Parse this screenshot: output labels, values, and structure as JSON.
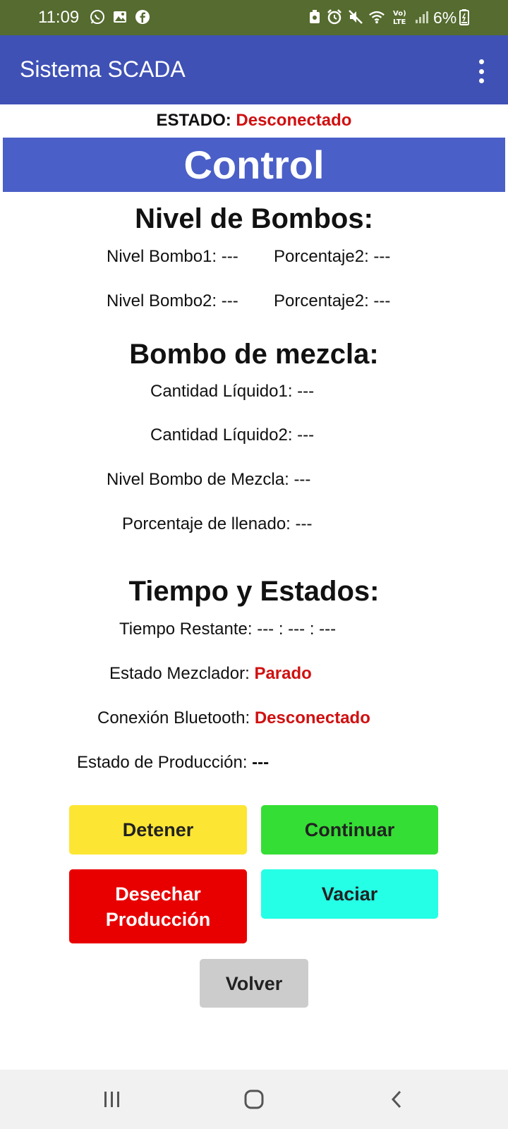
{
  "status_bar": {
    "time": "11:09",
    "battery": "6%",
    "left_icons": [
      "whatsapp-icon",
      "gallery-icon",
      "facebook-icon"
    ],
    "right_icons": [
      "battery-saver-icon",
      "alarm-icon",
      "mute-icon",
      "wifi-icon",
      "volte-icon",
      "signal-icon",
      "battery-icon"
    ]
  },
  "app_bar": {
    "title": "Sistema SCADA",
    "menu_icon": "overflow-menu-icon",
    "background": "#3f51b5"
  },
  "estado": {
    "label": "ESTADO:",
    "value": "Desconectado",
    "value_color": "#d01010"
  },
  "banner": {
    "title": "Control",
    "background": "#4a5fc7"
  },
  "nivel_bombos": {
    "title": "Nivel de Bombos:",
    "rows": [
      {
        "left": "Nivel Bombo1: ---",
        "right": "Porcentaje2: ---"
      },
      {
        "left": "Nivel Bombo2: ---",
        "right": "Porcentaje2: ---"
      }
    ]
  },
  "bombo_mezcla": {
    "title": "Bombo de mezcla:",
    "cantidad1": "Cantidad Líquido1: ---",
    "cantidad2": "Cantidad Líquido2: ---",
    "nivel": "Nivel Bombo de Mezcla: ---",
    "porcentaje": "Porcentaje de llenado: ---"
  },
  "tiempo_estados": {
    "title": "Tiempo y Estados:",
    "tiempo_restante": "Tiempo Restante: --- : --- : ---",
    "mezclador_label": "Estado Mezclador:",
    "mezclador_value": "Parado",
    "bluetooth_label": "Conexión Bluetooth:",
    "bluetooth_value": "Desconectado",
    "produccion_label": "Estado de Producción:",
    "produccion_value": "---"
  },
  "buttons": {
    "detener": "Detener",
    "continuar": "Continuar",
    "desechar_line1": "Desechar",
    "desechar_line2": "Producción",
    "vaciar": "Vaciar",
    "volver": "Volver",
    "colors": {
      "detener": "#fde633",
      "continuar": "#35de35",
      "desechar": "#e80000",
      "vaciar": "#25ffe6",
      "volver": "#cccccc"
    }
  },
  "nav_bar": {
    "items": [
      "recent-apps-icon",
      "home-icon",
      "back-icon"
    ]
  }
}
